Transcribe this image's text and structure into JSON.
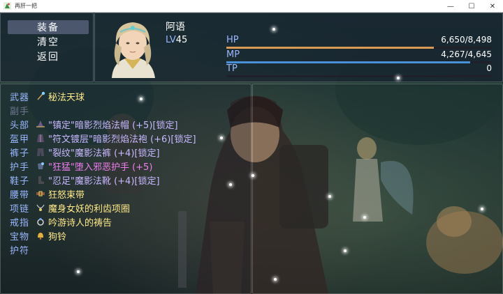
{
  "window": {
    "title": "再肝一把",
    "minimize": "—",
    "maximize": "☐",
    "close": "✕"
  },
  "menu": {
    "items": [
      {
        "label": "装备",
        "selected": true
      },
      {
        "label": "清空",
        "selected": false
      },
      {
        "label": "返回",
        "selected": false
      }
    ]
  },
  "actor": {
    "name": "阿语",
    "level_label": "LV",
    "level": "45",
    "hp": {
      "label": "HP",
      "value": "6,650/8,498",
      "ratio": 0.7825,
      "color": "#d89a55"
    },
    "mp": {
      "label": "MP",
      "value": "4,267/4,645",
      "ratio": 0.9186,
      "color": "#4a90d8"
    },
    "tp": {
      "label": "TP",
      "value": "0",
      "ratio": 0,
      "color": "#44aa66"
    }
  },
  "equipment": [
    {
      "slot": "武器",
      "item": "秘法天球",
      "color": "#ffe98a",
      "icon": "staff-icon",
      "empty": false
    },
    {
      "slot": "副手",
      "item": "",
      "color": "#ffffff",
      "icon": "",
      "empty": true
    },
    {
      "slot": "头部",
      "item": "\"镇定\"暗影烈焰法帽 (+5)[锁定]",
      "color": "#c8b8ff",
      "icon": "hat-icon",
      "empty": false
    },
    {
      "slot": "盔甲",
      "item": "\"符文镀层\"暗影烈焰法袍 (+6)[锁定]",
      "color": "#c8b8ff",
      "icon": "robe-icon",
      "empty": false
    },
    {
      "slot": "裤子",
      "item": "\"裂纹\"魔影法裤 (+4)[锁定]",
      "color": "#c8b8ff",
      "icon": "pants-icon",
      "empty": false
    },
    {
      "slot": "护手",
      "item": "\"狂猛\"堕入邪恶护手 (+5)",
      "color": "#f07ef0",
      "icon": "gauntlet-icon",
      "empty": false
    },
    {
      "slot": "鞋子",
      "item": "\"忍足\"魔影法靴 (+4)[锁定]",
      "color": "#c8b8ff",
      "icon": "boots-icon",
      "empty": false
    },
    {
      "slot": "腰带",
      "item": "狂怒束带",
      "color": "#ffe98a",
      "icon": "belt-icon",
      "empty": false
    },
    {
      "slot": "项链",
      "item": "魔身女妖的利齿项圈",
      "color": "#ffe98a",
      "icon": "necklace-icon",
      "empty": false
    },
    {
      "slot": "戒指",
      "item": "吟游诗人的祷告",
      "color": "#ffe98a",
      "icon": "ring-icon",
      "empty": false
    },
    {
      "slot": "宝物",
      "item": "狗铃",
      "color": "#ffe98a",
      "icon": "bell-icon",
      "empty": false
    },
    {
      "slot": "护符",
      "item": "",
      "color": "#ffffff",
      "icon": "",
      "empty": false
    }
  ],
  "icons": {
    "app": "game-app-icon",
    "portrait": "character-portrait"
  }
}
